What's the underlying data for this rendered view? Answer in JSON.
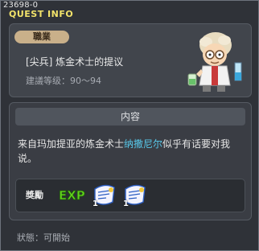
{
  "window": {
    "id": "23698-0",
    "title": "QUEST INFO"
  },
  "quest": {
    "type_badge": "職業",
    "name": "[尖兵] 炼金术士的提议",
    "level_label": "建議等级：90～94"
  },
  "content": {
    "header": "内容",
    "desc_prefix": "来自玛加提亚的炼金术士",
    "npc_name": "纳撒尼尔",
    "desc_suffix": "似乎有话要对我说。"
  },
  "reward": {
    "label": "獎勵",
    "exp_text": "EXP",
    "items": [
      {
        "qty": "1"
      },
      {
        "qty": "1"
      }
    ]
  },
  "status": {
    "text": "狀態：可開始"
  },
  "colors": {
    "title": "#f1e26a",
    "npc_name": "#58c8ea",
    "badge": "#c9b08a",
    "exp_green": "#62d21c"
  }
}
